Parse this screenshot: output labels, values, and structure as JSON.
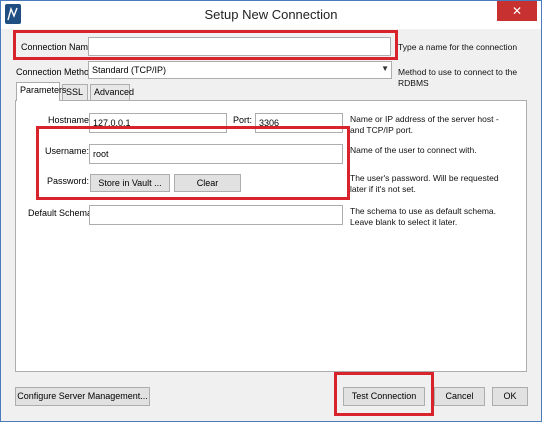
{
  "window": {
    "title": "Setup New Connection",
    "close_glyph": "✕",
    "icon": "mysql-workbench-icon"
  },
  "connection_name": {
    "label": "Connection Name:",
    "value": "",
    "hint": "Type a name for the connection"
  },
  "connection_method": {
    "label": "Connection Method:",
    "selected": "Standard (TCP/IP)",
    "hint": "Method to use to connect to the RDBMS"
  },
  "tabs": [
    {
      "label": "Parameters",
      "active": true
    },
    {
      "label": "SSL",
      "active": false
    },
    {
      "label": "Advanced",
      "active": false
    }
  ],
  "parameters": {
    "hostname": {
      "label": "Hostname:",
      "value": "127.0.0.1",
      "hint": "Name or IP address of the server host - and TCP/IP port."
    },
    "port": {
      "label": "Port:",
      "value": "3306"
    },
    "username": {
      "label": "Username:",
      "value": "root",
      "hint": "Name of the user to connect with."
    },
    "password": {
      "label": "Password:",
      "store_label": "Store in Vault ...",
      "clear_label": "Clear",
      "hint": "The user's password. Will be requested later if it's not set."
    },
    "default_schema": {
      "label": "Default Schema:",
      "value": "",
      "hint": "The schema to use as default schema. Leave blank to select it later."
    }
  },
  "footer": {
    "configure_label": "Configure Server Management...",
    "test_label": "Test Connection",
    "cancel_label": "Cancel",
    "ok_label": "OK"
  },
  "colors": {
    "highlight": "#d9232c",
    "close_button": "#c7312f",
    "app_icon": "#1f4f82"
  }
}
